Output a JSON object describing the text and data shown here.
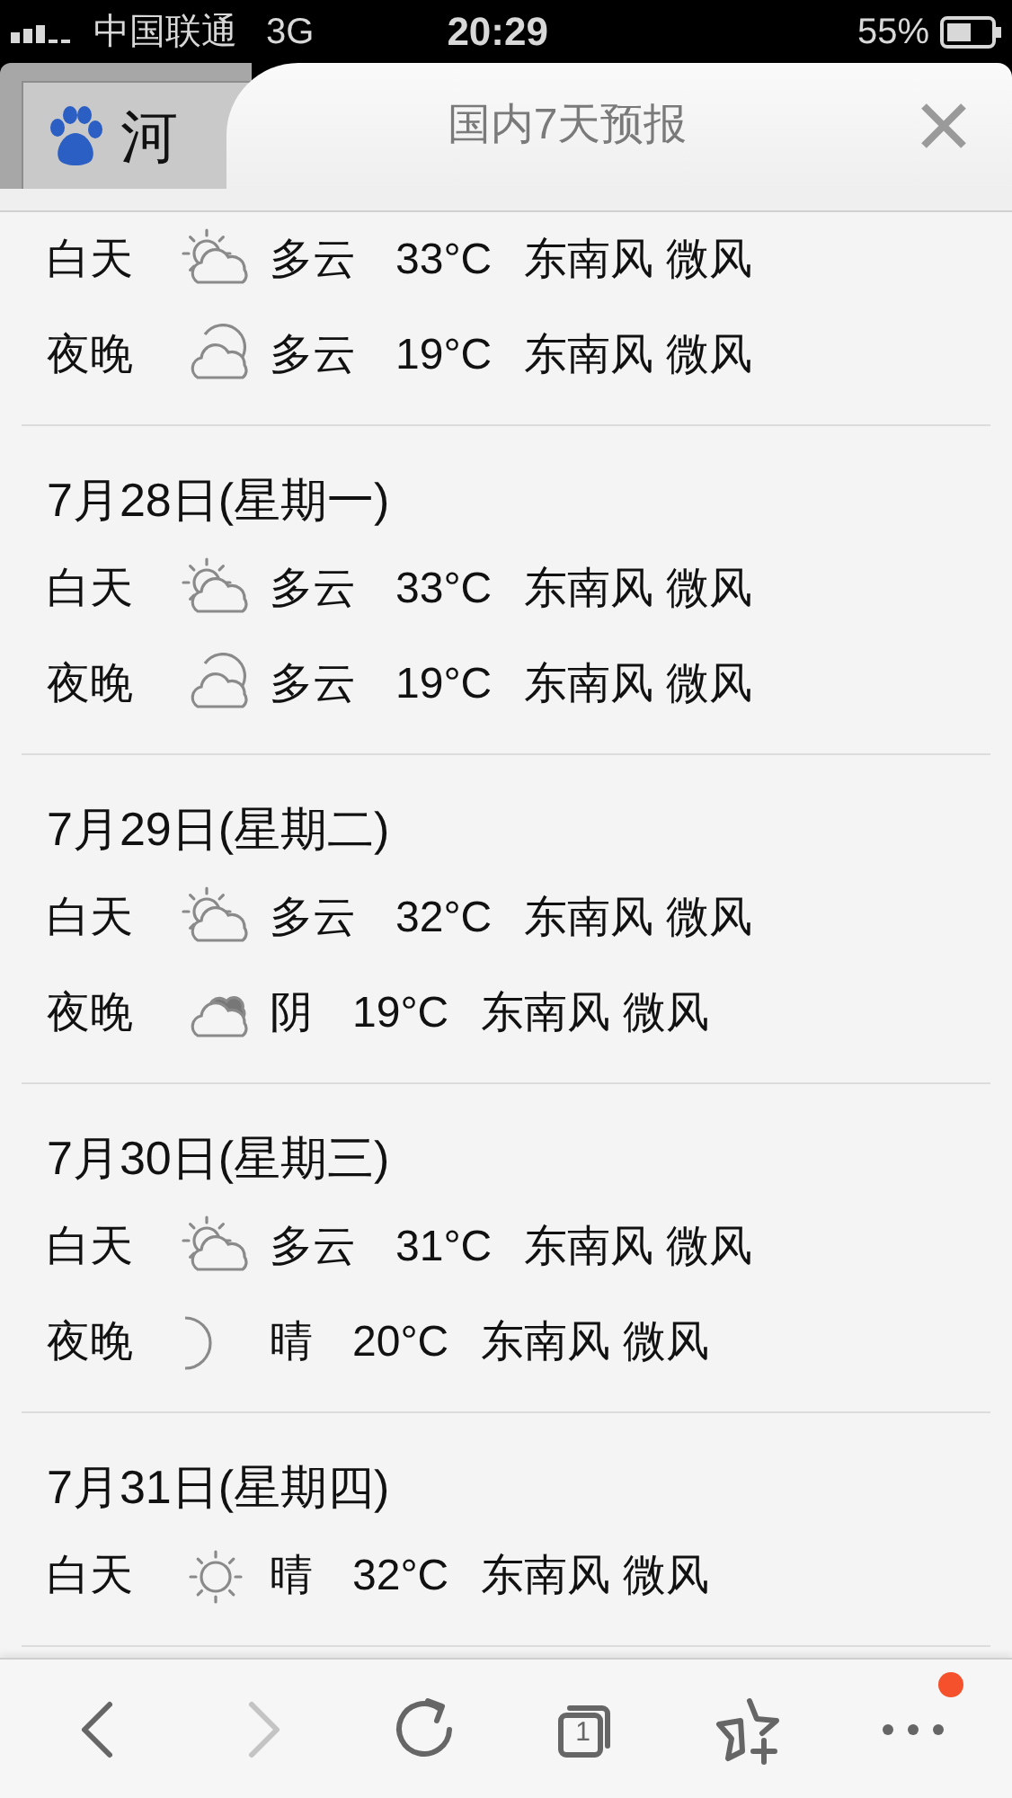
{
  "status_bar": {
    "carrier": "中国联通",
    "network": "3G",
    "time": "20:29",
    "battery": "55%"
  },
  "background_tab": {
    "title": "河"
  },
  "panel": {
    "title": "国内7天预报"
  },
  "days": [
    {
      "rows": [
        {
          "period": "白天",
          "kind": "partly-cloudy",
          "condition": "多云",
          "temp": "33°C",
          "wind": "东南风 微风"
        },
        {
          "period": "夜晚",
          "kind": "cloudy-night",
          "condition": "多云",
          "temp": "19°C",
          "wind": "东南风 微风"
        }
      ]
    },
    {
      "date": "7月28日(星期一)",
      "rows": [
        {
          "period": "白天",
          "kind": "partly-cloudy",
          "condition": "多云",
          "temp": "33°C",
          "wind": "东南风 微风"
        },
        {
          "period": "夜晚",
          "kind": "cloudy-night",
          "condition": "多云",
          "temp": "19°C",
          "wind": "东南风 微风"
        }
      ]
    },
    {
      "date": "7月29日(星期二)",
      "rows": [
        {
          "period": "白天",
          "kind": "partly-cloudy",
          "condition": "多云",
          "temp": "32°C",
          "wind": "东南风 微风"
        },
        {
          "period": "夜晚",
          "kind": "overcast",
          "condition": "阴",
          "temp": "19°C",
          "wind": "东南风 微风"
        }
      ]
    },
    {
      "date": "7月30日(星期三)",
      "rows": [
        {
          "period": "白天",
          "kind": "partly-cloudy",
          "condition": "多云",
          "temp": "31°C",
          "wind": "东南风 微风"
        },
        {
          "period": "夜晚",
          "kind": "clear-night",
          "condition": "晴",
          "temp": "20°C",
          "wind": "东南风 微风"
        }
      ]
    },
    {
      "date": "7月31日(星期四)",
      "rows": [
        {
          "period": "白天",
          "kind": "sunny",
          "condition": "晴",
          "temp": "32°C",
          "wind": "东南风 微风"
        }
      ]
    }
  ],
  "toolbar": [
    {
      "kind": "back",
      "disabled": false
    },
    {
      "kind": "forward",
      "disabled": true
    },
    {
      "kind": "refresh",
      "disabled": false
    },
    {
      "kind": "tabs",
      "disabled": false,
      "count": "1"
    },
    {
      "kind": "bookmark",
      "disabled": false
    },
    {
      "kind": "more",
      "disabled": false,
      "notification": true
    }
  ]
}
